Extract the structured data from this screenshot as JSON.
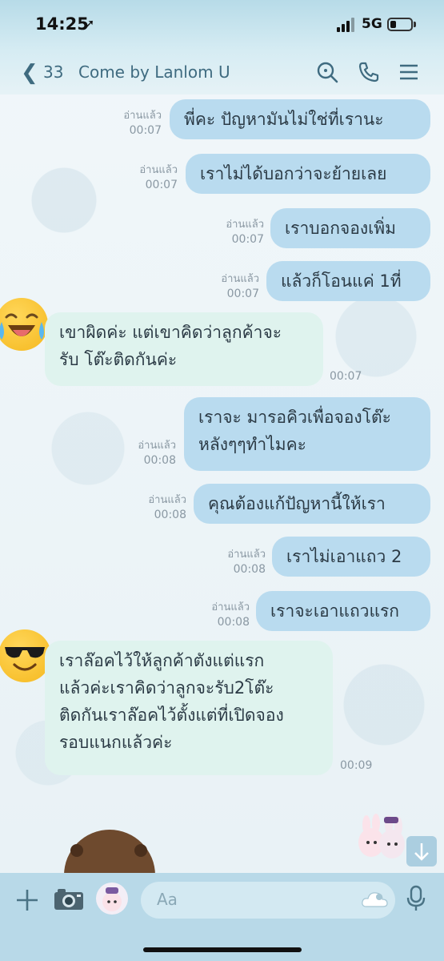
{
  "status": {
    "time": "14:25",
    "location_glyph": "➚",
    "network": "5G",
    "battery_level": 0.3
  },
  "header": {
    "back_icon": "chevron-left-icon",
    "unread_count": "33",
    "title": "Come by Lanlom U",
    "icons": [
      "search-icon",
      "phone-icon",
      "menu-icon"
    ]
  },
  "messages": [
    {
      "side": "sent",
      "text": "พี่คะ ปัญหามันไม่ใช่ที่เรานะ",
      "read": "อ่านแล้ว",
      "time": "00:07"
    },
    {
      "side": "sent",
      "text": "เราไม่ได้บอกว่าจะย้ายเลย",
      "read": "อ่านแล้ว",
      "time": "00:07"
    },
    {
      "side": "sent",
      "text": "เราบอกจองเพิ่ม",
      "read": "อ่านแล้ว",
      "time": "00:07"
    },
    {
      "side": "sent",
      "text": "แล้วก็โอนแค่ 1ที่",
      "read": "อ่านแล้ว",
      "time": "00:07"
    },
    {
      "side": "recv",
      "avatar": "laughing-crying-emoji",
      "lines": [
        "เขาผิดค่ะ แต่เขาคิดว่าลูกค้าจะ",
        "รับ โต๊ะติดกันค่ะ"
      ],
      "time": "00:07"
    },
    {
      "side": "sent",
      "lines": [
        "เราจะ มารอคิวเพื่อจองโต๊ะ",
        "หลังๆๆทำไมคะ"
      ],
      "read": "อ่านแล้ว",
      "time": "00:08"
    },
    {
      "side": "sent",
      "text": "คุณต้องแก้ปัญหานี้ให้เรา",
      "read": "อ่านแล้ว",
      "time": "00:08"
    },
    {
      "side": "sent",
      "text": "เราไม่เอาแถว 2",
      "read": "อ่านแล้ว",
      "time": "00:08"
    },
    {
      "side": "sent",
      "text": "เราจะเอาแถวแรก",
      "read": "อ่านแล้ว",
      "time": "00:08"
    },
    {
      "side": "recv",
      "avatar": "sunglasses-emoji",
      "lines": [
        "เราล๊อคไว้ให้ลูกค้าตังแต่แรก",
        "แล้วค่ะเราคิดว่าลูกจะรับ2โต๊ะ",
        "ติดกันเราล๊อคไว้ตั้งแต่ที่เปิดจอง",
        "รอบแนกแล้วค่ะ"
      ],
      "time": "00:09"
    }
  ],
  "composer": {
    "placeholder": "Aa",
    "icons": [
      "plus-icon",
      "camera-icon",
      "sticker-icon",
      "emoji-cloud-icon",
      "microphone-icon"
    ]
  },
  "colors": {
    "sent_bubble": "#b9dbef",
    "recv_bubble": "#dff3ee",
    "header_text": "#3f6b80"
  }
}
